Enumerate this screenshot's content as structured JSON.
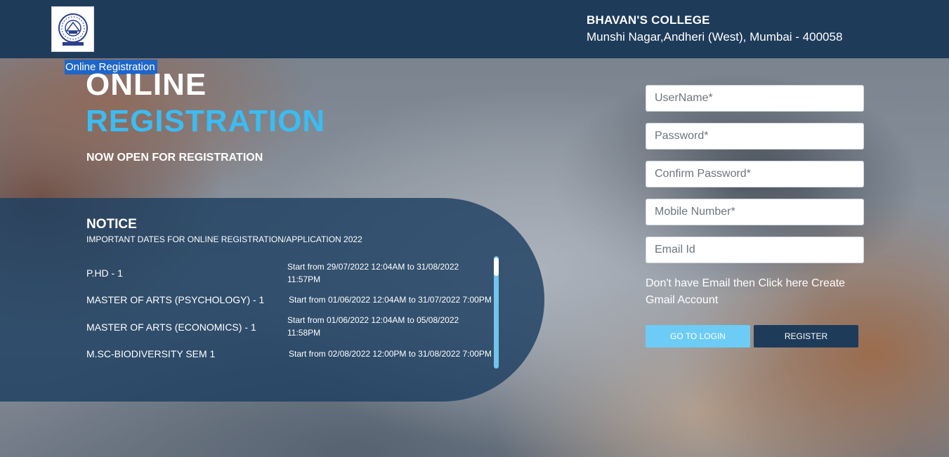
{
  "header": {
    "college_name": "BHAVAN'S COLLEGE",
    "college_address": "Munshi Nagar,Andheri (West), Mumbai - 400058",
    "screen_reader_label": "Online Registration"
  },
  "hero": {
    "line1": "ONLINE",
    "line2": "REGISTRATION",
    "subtitle": "NOW OPEN FOR REGISTRATION",
    "accent_color": "#3bbcf2"
  },
  "notice": {
    "title": "NOTICE",
    "subtitle": "IMPORTANT DATES FOR ONLINE REGISTRATION/APPLICATION 2022",
    "items": [
      {
        "course": "P.HD - 1",
        "dates": "Start from 29/07/2022 12:04AM to 31/08/2022 11:57PM"
      },
      {
        "course": "MASTER OF ARTS (PSYCHOLOGY) - 1",
        "dates": "Start from 01/06/2022 12:04AM to 31/07/2022 7:00PM"
      },
      {
        "course": "MASTER OF ARTS (ECONOMICS) - 1",
        "dates": "Start from 01/06/2022 12:04AM to 05/08/2022 11:58PM"
      },
      {
        "course": "M.SC-BIODIVERSITY SEM 1",
        "dates": "Start from 02/08/2022 12:00PM to 31/08/2022 7:00PM"
      }
    ]
  },
  "form": {
    "username_placeholder": "UserName*",
    "password_placeholder": "Password*",
    "confirm_password_placeholder": "Confirm Password*",
    "mobile_placeholder": "Mobile Number*",
    "email_placeholder": "Email Id",
    "gmail_link": "Don't have Email then Click here Create Gmail Account",
    "login_button": "GO TO LOGIN",
    "register_button": "REGISTER"
  },
  "colors": {
    "header_bg": "#1e3b5a",
    "login_button_bg": "#6cccf5",
    "register_button_bg": "#1e3b5a"
  }
}
